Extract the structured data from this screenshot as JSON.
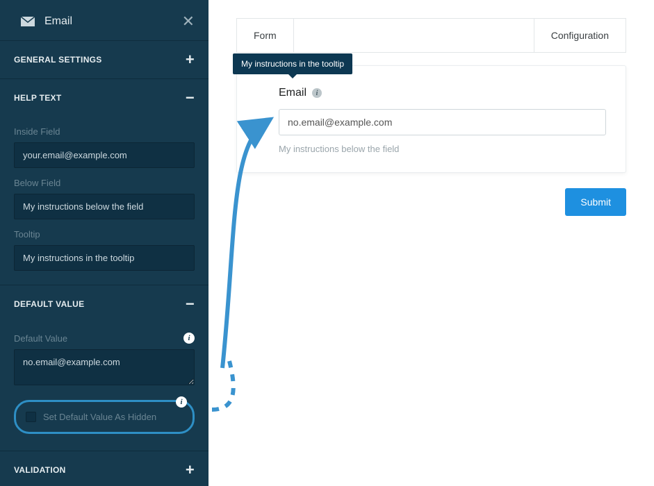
{
  "sidebar": {
    "title": "Email",
    "sections": {
      "general": {
        "title": "GENERAL SETTINGS",
        "toggle": "+"
      },
      "help": {
        "title": "HELP TEXT",
        "toggle": "−",
        "inside_label": "Inside Field",
        "inside_value": "your.email@example.com",
        "below_label": "Below Field",
        "below_value": "My instructions below the field",
        "tooltip_label": "Tooltip",
        "tooltip_value": "My instructions in the tooltip"
      },
      "default": {
        "title": "DEFAULT VALUE",
        "toggle": "−",
        "value_label": "Default Value",
        "value": "no.email@example.com",
        "hidden_label": "Set Default Value As Hidden"
      },
      "validation": {
        "title": "VALIDATION",
        "toggle": "+"
      }
    }
  },
  "main": {
    "tabs": {
      "form": "Form",
      "config": "Configuration"
    },
    "tooltip_text": "My instructions in the tooltip",
    "field_label": "Email",
    "email_value": "no.email@example.com",
    "hint": "My instructions below the field",
    "submit": "Submit"
  },
  "colors": {
    "sidebar_bg": "#163a4e",
    "accent": "#1e90e0",
    "highlight_ring": "#2e8fc5",
    "tooltip_bg": "#0d3852"
  }
}
